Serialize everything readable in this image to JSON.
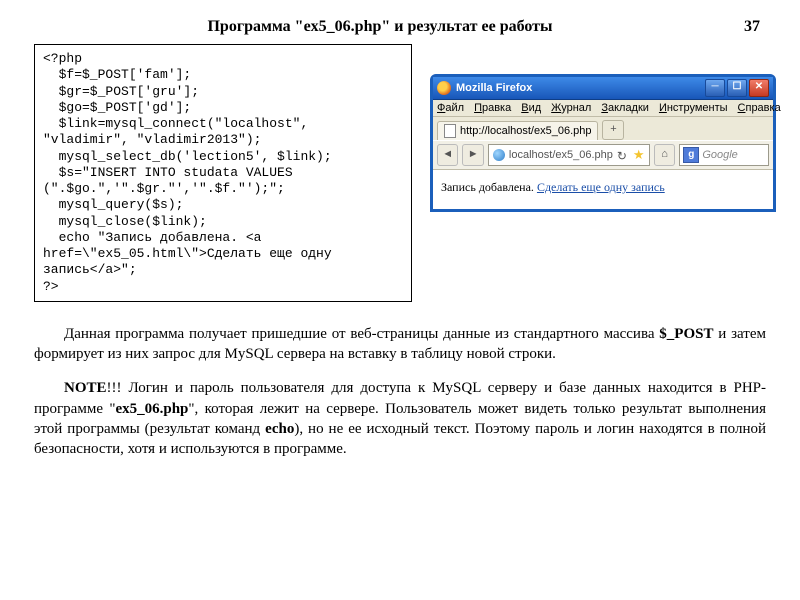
{
  "header": {
    "title": "Программа \"ex5_06.php\" и  результат  ее  работы",
    "page_number": "37"
  },
  "code": "<?php\n  $f=$_POST['fam'];\n  $gr=$_POST['gru'];\n  $go=$_POST['gd'];\n  $link=mysql_connect(\"localhost\",\n\"vladimir\", \"vladimir2013\");\n  mysql_select_db('lection5', $link);\n  $s=\"INSERT INTO studata VALUES\n(\".$go.\",'\".$gr.\"','\".$f.\"');\";\n  mysql_query($s);\n  mysql_close($link);\n  echo \"Запись добавлена. <a\nhref=\\\"ex5_05.html\\\">Сделать еще одну\nзапись</a>\";\n?>",
  "browser": {
    "window_title": "Mozilla Firefox",
    "menu": [
      "Файл",
      "Правка",
      "Вид",
      "Журнал",
      "Закладки",
      "Инструменты",
      "Справка"
    ],
    "tab_label": "http://localhost/ex5_06.php",
    "url": "localhost/ex5_06.php",
    "search_placeholder": "Google",
    "page": {
      "text": "Запись добавлена. ",
      "link": "Сделать еще одну запись"
    }
  },
  "paragraphs": {
    "p1_a": "Данная программа получает пришедшие от веб-страницы данные из стандартного массива ",
    "p1_bold": "$_POST",
    "p1_b": " и затем формирует из  них  запрос  для MySQL сервера  на  вставку  в  таблицу новой строки.",
    "p2_bold": "NOTE",
    "p2_a": "!!! Логин и пароль пользователя для доступа к MySQL серверу и базе данных находится в PHP-программе \"",
    "p2_em": "ex5_06.php",
    "p2_b": "\", которая лежит на сервере. Пользователь может видеть только результат выполнения этой программы (результат команд ",
    "p2_echo": "echo",
    "p2_c": "), но не ее исходный текст. Поэтому пароль и логин находятся в полной безопасности, хотя и используются в программе."
  }
}
